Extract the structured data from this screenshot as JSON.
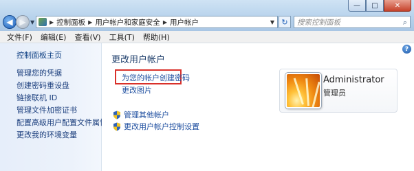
{
  "window": {
    "minimize_glyph": "—",
    "maximize_glyph": "□",
    "close_glyph": "✕"
  },
  "nav": {
    "back_icon": "arrow-left-icon",
    "forward_icon": "arrow-right-icon"
  },
  "address": {
    "crumbs": [
      "控制面板",
      "用户帐户和家庭安全",
      "用户帐户"
    ],
    "refresh_glyph": "↻"
  },
  "search": {
    "placeholder": "搜索控制面板",
    "icon": "search-icon"
  },
  "menu": {
    "items": [
      "文件(F)",
      "编辑(E)",
      "查看(V)",
      "工具(T)",
      "帮助(H)"
    ]
  },
  "sidebar": {
    "home": "控制面板主页",
    "items": [
      "管理您的凭据",
      "创建密码重设盘",
      "链接联机 ID",
      "管理文件加密证书",
      "配置高级用户配置文件属性",
      "更改我的环境变量"
    ]
  },
  "main": {
    "title": "更改用户帐户",
    "links": {
      "create_password": "为您的帐户创建密码",
      "change_picture": "更改图片"
    },
    "shield_links": [
      "管理其他帐户",
      "更改用户帐户控制设置"
    ],
    "help_glyph": "?"
  },
  "account": {
    "name": "Administrator",
    "role": "管理员"
  },
  "colors": {
    "link": "#1f4fa0",
    "highlight": "#d9302a",
    "titlebar": "#b8d3ec"
  }
}
